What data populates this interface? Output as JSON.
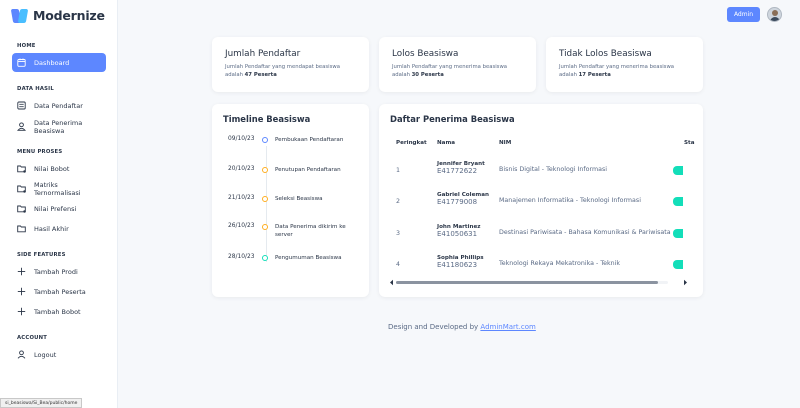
{
  "brand": {
    "name": "Modernize",
    "accent": "#5d87ff"
  },
  "sidebar": {
    "sections": [
      {
        "title": "HOME",
        "items": [
          {
            "label": "Dashboard",
            "icon": "calendar-icon",
            "active": true
          }
        ]
      },
      {
        "title": "DATA HASIL",
        "items": [
          {
            "label": "Data Pendaftar",
            "icon": "list-icon"
          },
          {
            "label": "Data Penerima Beasiswa",
            "icon": "user-icon"
          }
        ]
      },
      {
        "title": "MENU PROSES",
        "items": [
          {
            "label": "Nilai Bobot",
            "icon": "folder-icon"
          },
          {
            "label": "Matriks Ternormalisasi",
            "icon": "folder-icon"
          },
          {
            "label": "Nilai Prefensi",
            "icon": "folder-icon"
          },
          {
            "label": "Hasil Akhir",
            "icon": "folder-icon"
          }
        ]
      },
      {
        "title": "SIDE FEATURES",
        "items": [
          {
            "label": "Tambah Prodi",
            "icon": "plus-icon"
          },
          {
            "label": "Tambah Peserta",
            "icon": "plus-icon"
          },
          {
            "label": "Tambah Bobot",
            "icon": "plus-icon"
          }
        ]
      },
      {
        "title": "ACCOUNT",
        "items": [
          {
            "label": "Logout",
            "icon": "user-icon"
          }
        ]
      }
    ]
  },
  "topbar": {
    "admin_label": "Admin"
  },
  "stats": [
    {
      "title": "Jumlah Pendaftar",
      "desc_prefix": "Jumlah Pendaftar yang mendapat beasiswa adalah",
      "count": "47 Peserta"
    },
    {
      "title": "Lolos Beasiswa",
      "desc_prefix": "Jumlah Pendaftar yang menerima beasiswa adalah",
      "count": "30 Peserta"
    },
    {
      "title": "Tidak Lolos Beasiswa",
      "desc_prefix": "Jumlah Pendaftar yang menerima beasiswa adalah",
      "count": "17 Peserta"
    }
  ],
  "timeline": {
    "title": "Timeline Beasiswa",
    "events": [
      {
        "date": "09/10/23",
        "text": "Pembukaan Pendaftaran",
        "color": "#5d87ff"
      },
      {
        "date": "20/10/23",
        "text": "Penutupan Pendaftaran",
        "color": "#ffae1f"
      },
      {
        "date": "21/10/23",
        "text": "Seleksi Beasiswa",
        "color": "#ffae1f"
      },
      {
        "date": "26/10/23",
        "text": "Data Penerima dikirim ke server",
        "color": "#ffae1f"
      },
      {
        "date": "28/10/23",
        "text": "Pengumuman Beasiswa",
        "color": "#13deb9"
      }
    ]
  },
  "recipients": {
    "title": "Daftar Penerima Beasiswa",
    "columns": [
      "Peringkat",
      "Nama",
      "NIM",
      "",
      "Sta"
    ],
    "rows": [
      {
        "rank": "1",
        "name": "Jennifer Bryant",
        "nim": "E41772622",
        "prodi": "Bisnis Digital - Teknologi Informasi"
      },
      {
        "rank": "2",
        "name": "Gabriel Coleman",
        "nim": "E41779008",
        "prodi": "Manajemen Informatika - Teknologi Informasi"
      },
      {
        "rank": "3",
        "name": "John Martinez",
        "nim": "E41050631",
        "prodi": "Destinasi Pariwisata - Bahasa Komunikasi & Pariwisata"
      },
      {
        "rank": "4",
        "name": "Sophia Phillips",
        "nim": "E41180623",
        "prodi": "Teknologi Rekaya Mekatronika - Teknik"
      }
    ],
    "status_color": "#13deb9",
    "scroll_position": 0.95
  },
  "footer": {
    "prefix": "Design and Developed by",
    "link": "AdminMart.com"
  },
  "status_bar": {
    "url": "si_beasiswa/Si_Bea/public/home"
  }
}
